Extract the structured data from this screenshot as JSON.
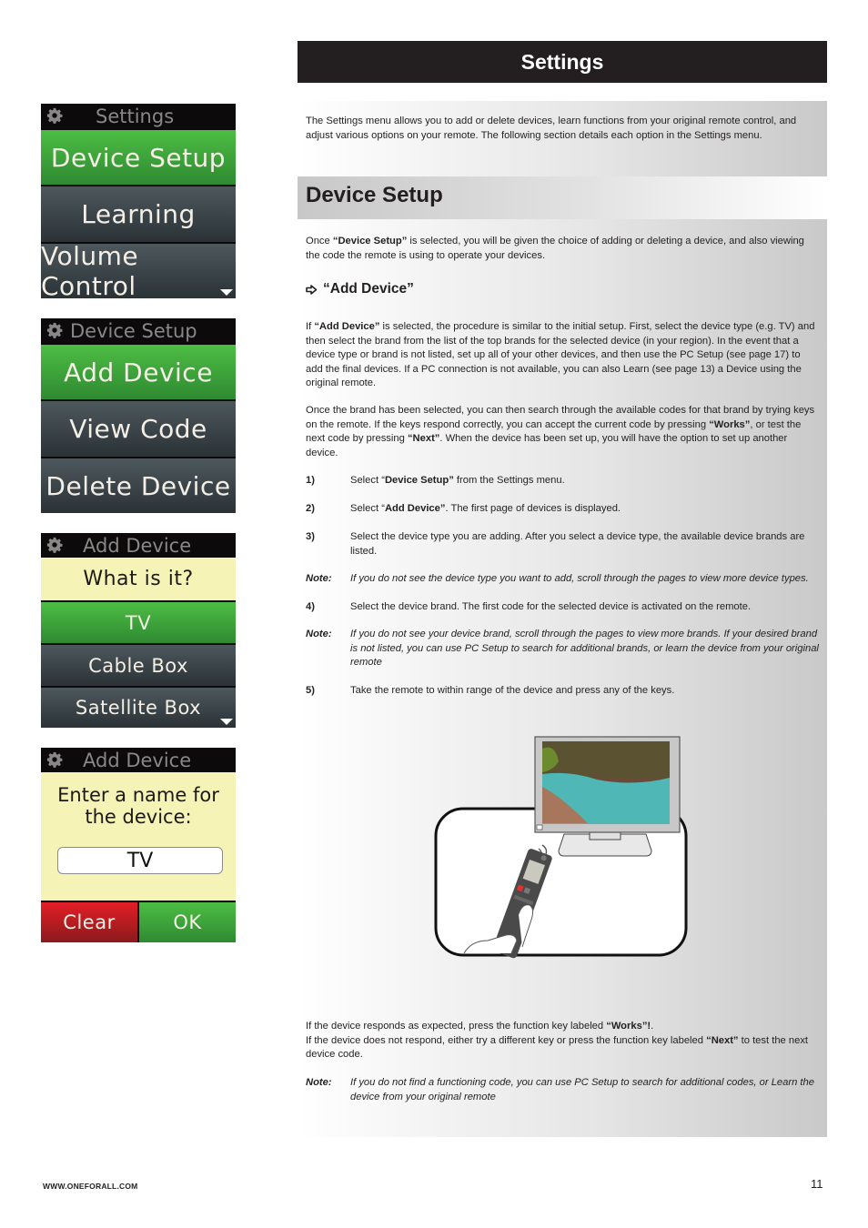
{
  "page": {
    "banner_title": "Settings",
    "footer_url": "WWW.ONEFORALL.COM",
    "page_number": "11"
  },
  "screens": [
    {
      "header": "Settings",
      "items": [
        {
          "label": "Device Setup",
          "style": "green"
        },
        {
          "label": "Learning",
          "style": "dark"
        },
        {
          "label": "Volume Control",
          "style": "dark",
          "scroll_down": true
        }
      ]
    },
    {
      "header": "Device Setup",
      "items": [
        {
          "label": "Add Device",
          "style": "green"
        },
        {
          "label": "View Code",
          "style": "dark"
        },
        {
          "label": "Delete Device",
          "style": "dark"
        }
      ]
    },
    {
      "header": "Add Device",
      "prompt": "What is it?",
      "items": [
        {
          "label": "TV",
          "style": "green"
        },
        {
          "label": "Cable Box",
          "style": "dark"
        },
        {
          "label": "Satellite Box",
          "style": "dark",
          "scroll_down": true
        }
      ]
    },
    {
      "header": "Add Device",
      "prompt_line1": "Enter a name for",
      "prompt_line2": "the device:",
      "name_value": "TV",
      "clear_label": "Clear",
      "ok_label": "OK"
    }
  ],
  "intro": {
    "text": "The Settings menu allows you to add or delete devices, learn functions from your original remote control, and adjust various options on your remote. The following section details each option in the Settings menu."
  },
  "device_setup": {
    "title": "Device Setup",
    "intro_pre": "Once ",
    "intro_bold": "“Device Setup”",
    "intro_post": " is selected, you will be given the choice of adding or deleting a device, and also viewing the code the remote is using to operate your devices.",
    "add_device_heading": "“Add Device”",
    "para1_pre": "If ",
    "para1_bold": "“Add Device”",
    "para1_post": " is selected, the procedure is similar to the initial setup. First, select the device type (e.g. TV) and then select the brand from the list of the top brands for the selected device (in your region). In the event that a device type or brand is not listed, set up all of your other devices, and then use the PC Setup (see page 17) to add the final devices. If a PC connection is not available, you can also Learn (see page 13) a Device using the original remote.",
    "para2_a": "Once the brand has been selected, you can then search through the available codes for that brand by trying keys on the remote. If the keys respond correctly, you can accept the current code by pressing ",
    "para2_b": "“Works”",
    "para2_c": ", or test the next code by pressing ",
    "para2_d": "“Next”",
    "para2_e": ". When the device has been set up, you will have the option to set up another device.",
    "steps": [
      {
        "num": "1)",
        "pre": "Select “",
        "bold": "Device Setup”",
        "post": " from the Settings menu."
      },
      {
        "num": "2)",
        "pre": "Select “",
        "bold": "Add Device”",
        "post": ". The first page of devices is displayed."
      },
      {
        "num": "3)",
        "text": "Select the device type you are adding. After you select a device type, the available device brands are listed."
      },
      {
        "num": "Note:",
        "note": true,
        "text": "If you do not see the device type you want to add, scroll through the pages to view more device types."
      },
      {
        "num": "4)",
        "text": "Select the device brand. The first code for the selected device is activated on the remote."
      },
      {
        "num": "Note:",
        "note": true,
        "text": "If you do not see your device brand, scroll through the pages to view more brands.  If your desired brand is not listed, you can use PC Setup to search for additional brands, or learn the device from your original remote"
      },
      {
        "num": "5)",
        "text": "Take the remote to within range of the device and press any of the keys."
      }
    ],
    "illustration_alt": "Hand pointing remote at TV",
    "after_a": "If the device responds as expected, press the function key labeled ",
    "after_b": "“Works”!",
    "after_c": ".",
    "after2_a": "If the device does not respond, either try a different key or press the function key labeled ",
    "after2_b": "“Next”",
    "after2_c": " to test the next device code.",
    "final_note_label": "Note:",
    "final_note": "If you do not find a functioning code, you can use PC Setup to search for additional codes, or Learn the device from your original remote"
  }
}
